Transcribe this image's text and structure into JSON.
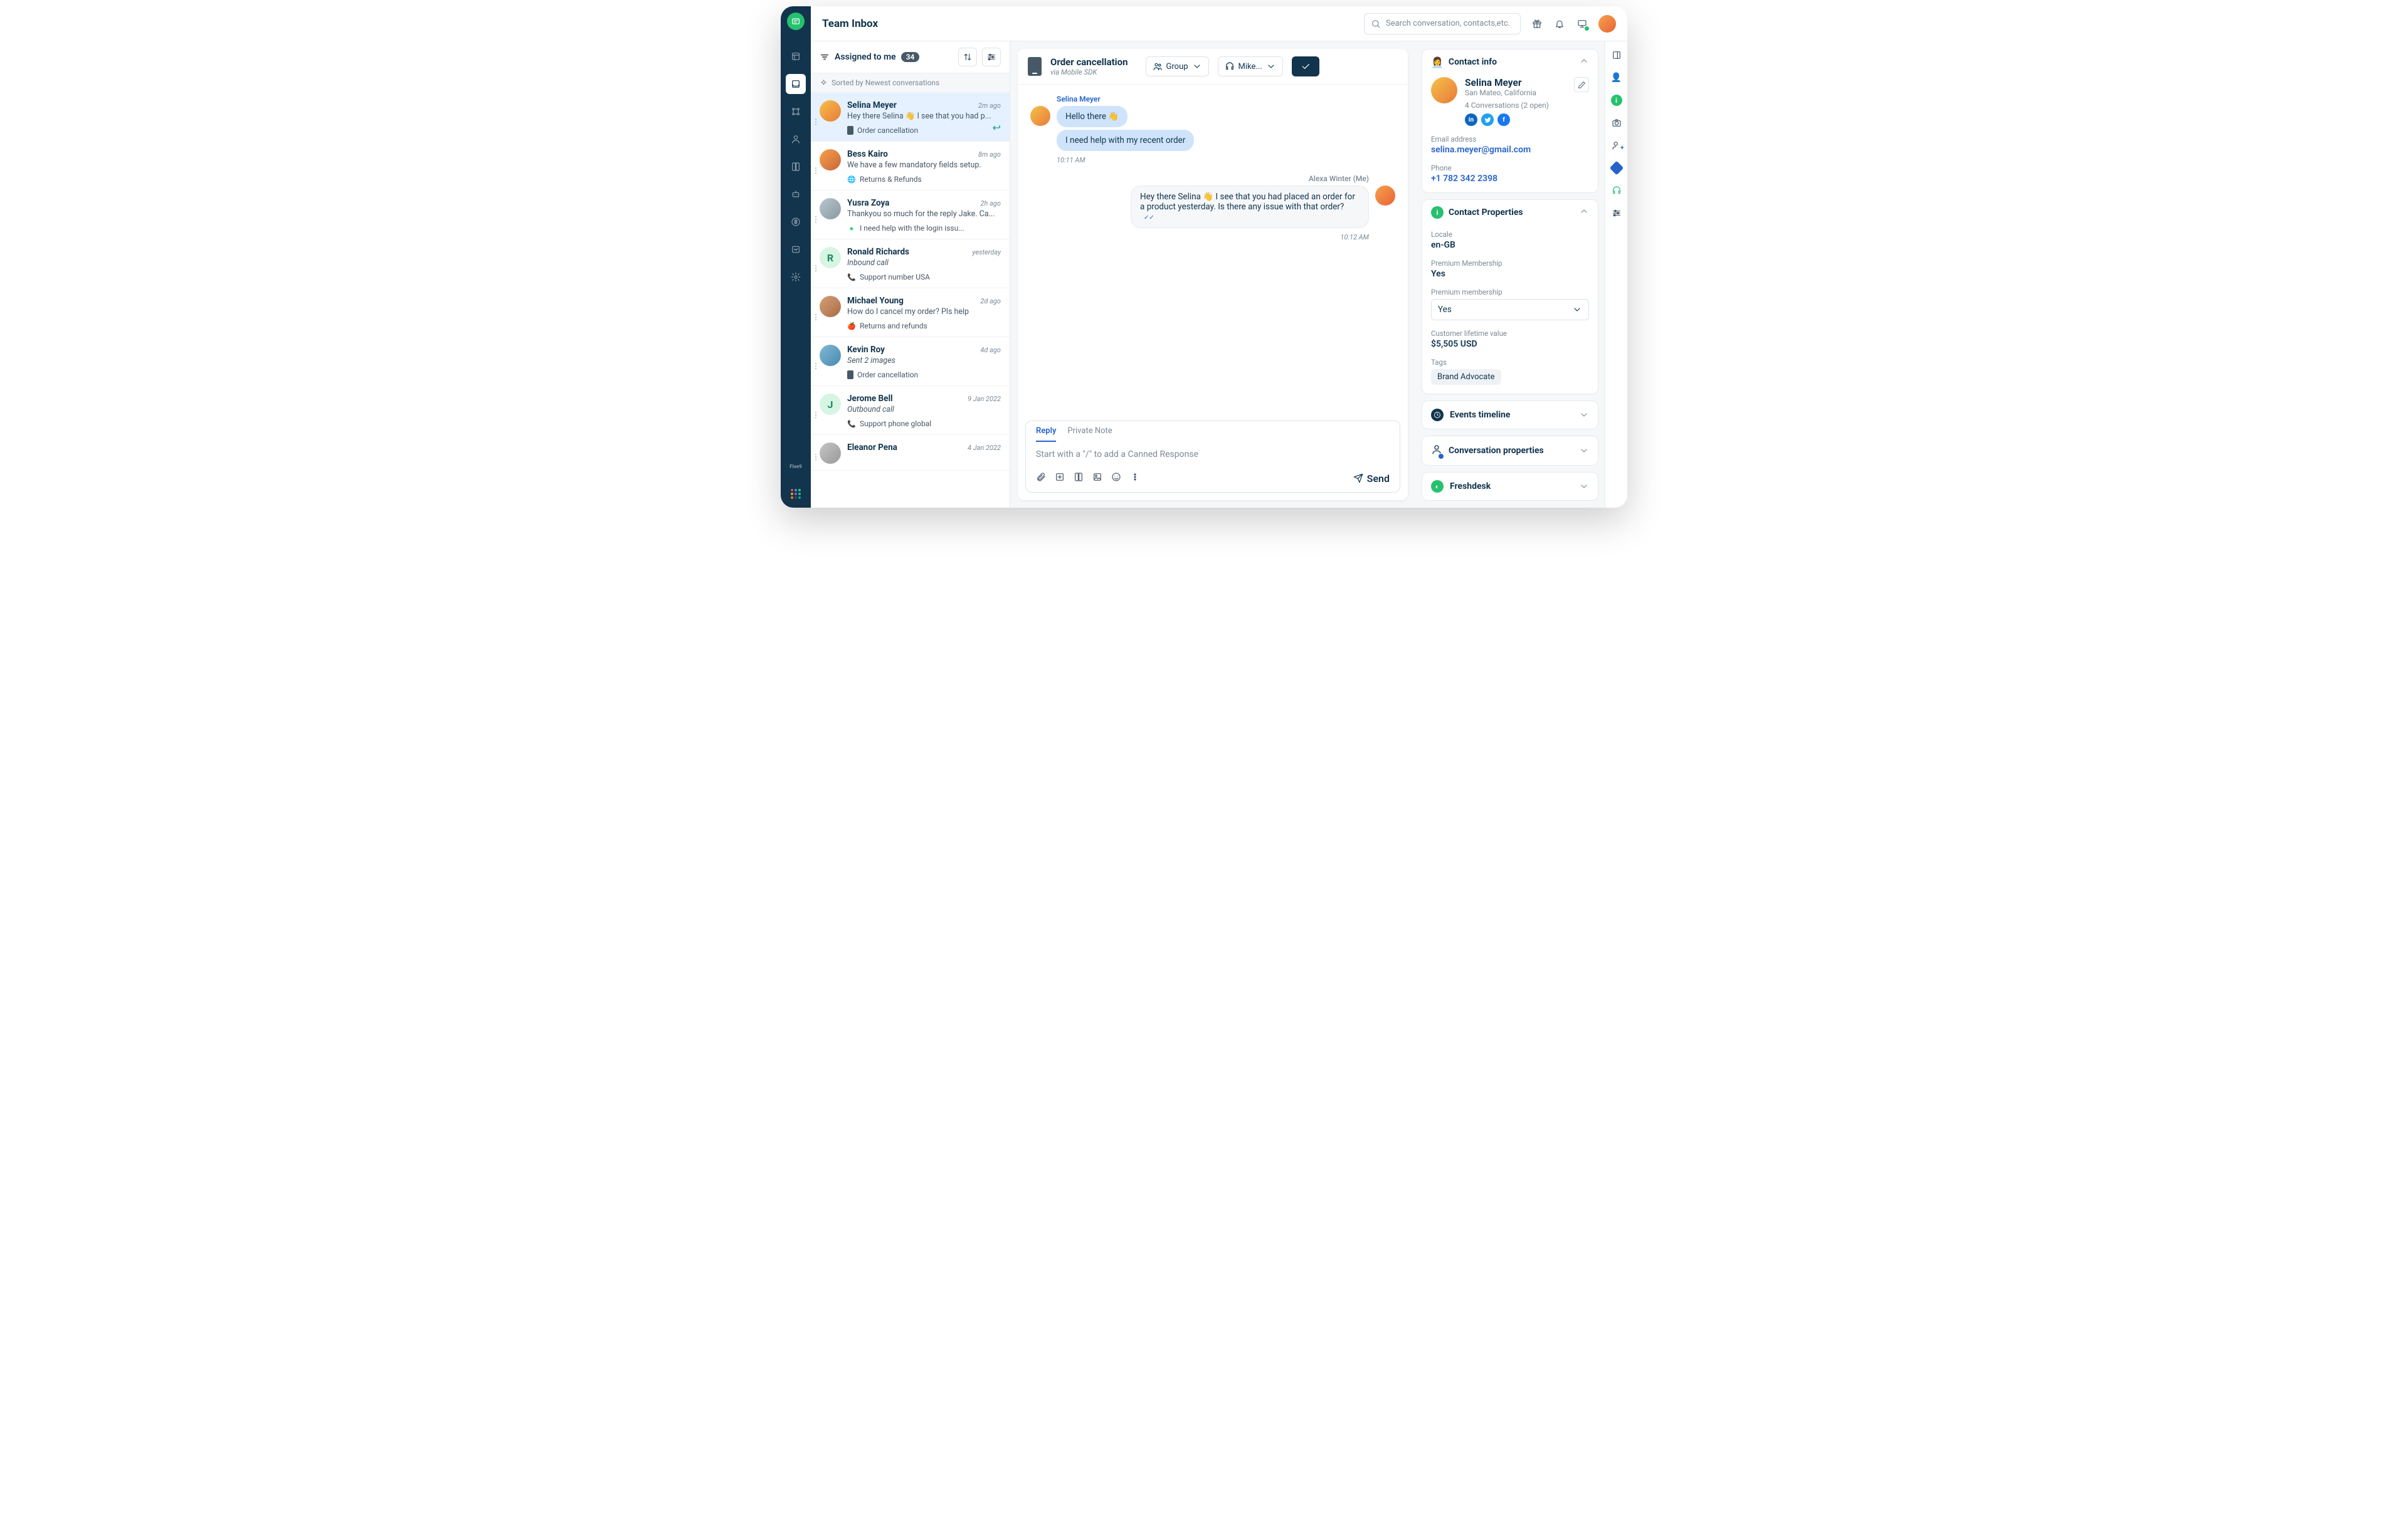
{
  "header": {
    "title": "Team Inbox",
    "search_placeholder": "Search conversation, contacts,etc."
  },
  "list": {
    "filter_label": "Assigned to me",
    "filter_count": "34",
    "sort_label": "Sorted by Newest conversations"
  },
  "conversations": [
    {
      "name": "Selina Meyer",
      "time": "2m ago",
      "preview": "Hey there Selina 👋 I see that you had p...",
      "topic": "Order cancellation",
      "channel": "mobile",
      "selected": true,
      "reply": true
    },
    {
      "name": "Bess Kairo",
      "time": "8m ago",
      "preview": "We have a few mandatory fields setup.",
      "topic": "Returns & Refunds",
      "channel": "web"
    },
    {
      "name": "Yusra Zoya",
      "time": "2h ago",
      "preview": "Thankyou so much for the reply Jake. Ca...",
      "topic": "I need help with the login issu...",
      "channel": "whatsapp"
    },
    {
      "name": "Ronald Richards",
      "time": "yesterday",
      "preview": "Inbound call",
      "italic": true,
      "topic": "Support number USA",
      "channel": "phone",
      "letter": "R"
    },
    {
      "name": "Michael Young",
      "time": "2d ago",
      "preview": "How do I cancel my order? Pls help",
      "topic": "Returns and refunds",
      "channel": "apple"
    },
    {
      "name": "Kevin Roy",
      "time": "4d ago",
      "preview": "Sent 2 images",
      "italic": true,
      "topic": "Order cancellation",
      "channel": "mobile"
    },
    {
      "name": "Jerome Bell",
      "time": "9 Jan 2022",
      "preview": "Outbound call",
      "italic": true,
      "topic": "Support phone global",
      "channel": "phone",
      "letter": "J"
    },
    {
      "name": "Eleanor Pena",
      "time": "4 Jan 2022",
      "preview": "",
      "topic": "",
      "channel": ""
    }
  ],
  "thread": {
    "subject": "Order cancellation",
    "via": "via Mobile SDK",
    "group_label": "Group",
    "agent_label": "Mike...",
    "messages_left": {
      "sender": "Selina Meyer",
      "bubbles": [
        "Hello there 👋",
        "I need help with my recent order"
      ],
      "time": "10:11 AM"
    },
    "messages_right": {
      "sender": "Alexa Winter (Me)",
      "bubble": "Hey there Selina 👋 I see that you had placed an order for a product yesterday. Is there any issue with that order?",
      "time": "10:12 AM"
    }
  },
  "composer": {
    "tab_reply": "Reply",
    "tab_note": "Private Note",
    "placeholder": "Start with a \"/\" to add a Canned Response",
    "send": "Send"
  },
  "contact": {
    "panel_title": "Contact info",
    "name": "Selina Meyer",
    "location": "San Mateo, California",
    "conversations": "4 Conversations",
    "open": "(2 open)",
    "email_label": "Email address",
    "email": "selina.meyer@gmail.com",
    "phone_label": "Phone",
    "phone": "+1 782 342 2398"
  },
  "properties": {
    "panel_title": "Contact Properties",
    "locale_label": "Locale",
    "locale_value": "en-GB",
    "premium_label": "Premium Membership",
    "premium_value": "Yes",
    "premium2_label": "Premium membership",
    "premium2_value": "Yes",
    "clv_label": "Customer lifetime value",
    "clv_value": "$5,505 USD",
    "tags_label": "Tags",
    "tag": "Brand Advocate"
  },
  "collapsibles": {
    "timeline": "Events timeline",
    "conv_props": "Conversation properties",
    "freshdesk": "Freshdesk"
  },
  "avatar_gradients": [
    "linear-gradient(135deg,#f6c14a,#e87a3a)",
    "linear-gradient(135deg,#f6a24a,#c9653a)",
    "linear-gradient(135deg,#b8c5cc,#8a9aa3)",
    "",
    "linear-gradient(135deg,#d6a078,#a86b45)",
    "linear-gradient(135deg,#7fb8d6,#4a8ab0)",
    "",
    "linear-gradient(135deg,#c5c5c5,#999)"
  ]
}
